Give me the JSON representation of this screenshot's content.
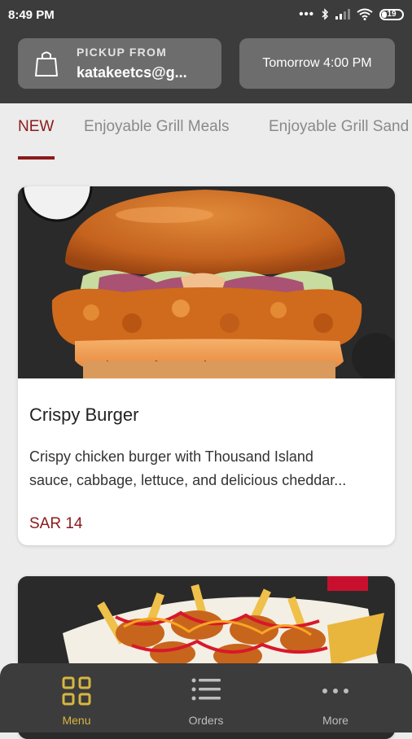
{
  "status_bar": {
    "time": "8:49 PM",
    "battery": "19",
    "icons": [
      "more-dots-icon",
      "bluetooth-icon",
      "signal-icon",
      "wifi-icon",
      "battery-icon"
    ]
  },
  "header": {
    "pickup_label": "PICKUP FROM",
    "pickup_value": "katakeetcs@g...",
    "time_label": "Tomorrow 4:00 PM"
  },
  "tabs": [
    {
      "label": "NEW",
      "active": true
    },
    {
      "label": "Enjoyable Grill Meals",
      "active": false
    },
    {
      "label": "Enjoyable Grill Sand",
      "active": false
    }
  ],
  "items": [
    {
      "name": "Crispy Burger",
      "description_line1": "Crispy chicken burger with Thousand Island",
      "description_line2": "sauce, cabbage, lettuce, and delicious cheddar...",
      "price": "SAR 14"
    },
    {
      "name": "",
      "description_line1": "",
      "description_line2": "",
      "price": ""
    }
  ],
  "bottom_nav": [
    {
      "label": "Menu",
      "icon": "grid-icon",
      "active": true
    },
    {
      "label": "Orders",
      "icon": "list-icon",
      "active": false
    },
    {
      "label": "More",
      "icon": "more-dots-icon",
      "active": false
    }
  ],
  "colors": {
    "accent": "#8b1a1a",
    "nav_active": "#d7b640",
    "header_bg": "#3c3c3c"
  }
}
